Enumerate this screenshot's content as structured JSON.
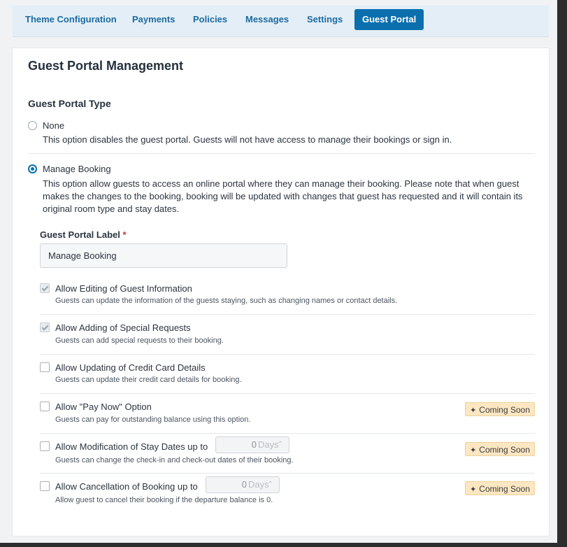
{
  "tabs": [
    {
      "label": "Theme Configuration",
      "active": false
    },
    {
      "label": "Payments",
      "active": false
    },
    {
      "label": "Policies",
      "active": false
    },
    {
      "label": "Messages",
      "active": false
    },
    {
      "label": "Settings",
      "active": false
    },
    {
      "label": "Guest Portal",
      "active": true
    }
  ],
  "card": {
    "title": "Guest Portal Management",
    "section_title": "Guest Portal Type",
    "options": {
      "none": {
        "label": "None",
        "description": "This option disables the guest portal. Guests will not have access to manage their bookings or sign in.",
        "selected": false
      },
      "manage": {
        "label": "Manage Booking",
        "description": "This option allow guests to access an online portal where they can manage their booking. Please note that when guest makes the changes to the booking, booking will be updated with changes that guest has requested and it will contain its original room type and stay dates.",
        "selected": true
      }
    },
    "portal_label": {
      "label": "Guest Portal Label",
      "required_mark": "*",
      "value": "Manage Booking"
    },
    "permissions": [
      {
        "title": "Allow Editing of Guest Information",
        "description": "Guests can update the information of the guests staying, such as changing names or contact details.",
        "checked": true
      },
      {
        "title": "Allow Adding of Special Requests",
        "description": "Guests can add special requests to their booking.",
        "checked": true
      },
      {
        "title": "Allow Updating of Credit Card Details",
        "description": "Guests can update their credit card details for booking.",
        "checked": false
      },
      {
        "title": "Allow \"Pay Now\" Option",
        "description": "Guests can pay for outstanding balance using this option.",
        "checked": false,
        "badge": "Coming Soon"
      },
      {
        "title": "Allow Modification of Stay Dates up to",
        "description": "Guests can change the check-in and check-out dates of their booking.",
        "checked": false,
        "badge": "Coming Soon",
        "stepper_value": "0",
        "stepper_unit": "Days"
      },
      {
        "title": "Allow Cancellation of Booking up to",
        "description": "Allow guest to cancel their booking if the departure balance is 0.",
        "checked": false,
        "badge": "Coming Soon",
        "stepper_value": "0",
        "stepper_unit": "Days"
      }
    ],
    "badge_icon": "sparkle-icon"
  },
  "colors": {
    "primary": "#0b6fae",
    "tab_text": "#1c6ba0",
    "badge_bg": "#fbe7c2",
    "required": "#d0332f"
  }
}
